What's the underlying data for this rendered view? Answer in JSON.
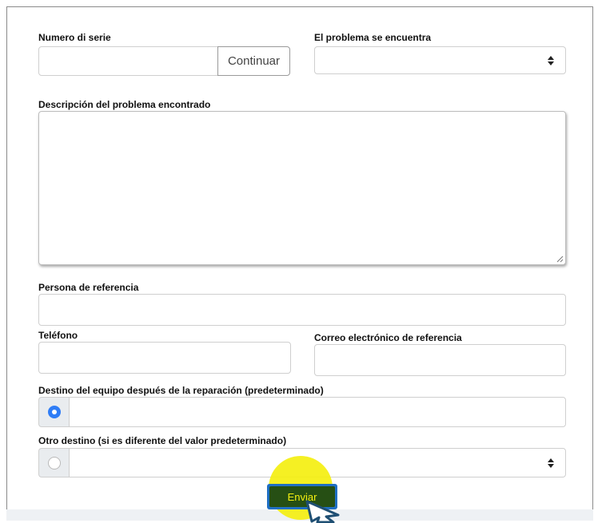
{
  "form": {
    "serial_label": "Numero di serie",
    "serial_value": "",
    "continue_label": "Continuar",
    "problem_location_label": "El problema se encuentra",
    "problem_location_value": "",
    "description_label": "Descripción del problema encontrado",
    "description_value": "",
    "contact_person_label": "Persona de referencia",
    "contact_person_value": "",
    "phone_label": "Teléfono",
    "phone_value": "",
    "email_label": "Correo electrónico de referencia",
    "email_value": "",
    "default_destination_label": "Destino del equipo después de la reparación (predeterminado)",
    "default_destination_value": "",
    "other_destination_label": "Otro destino (si es diferente del valor predeterminado)",
    "other_destination_value": "",
    "submit_label": "Enviar"
  },
  "colors": {
    "primary_button": "#1f6fc4",
    "radio_selected": "#2f7df6",
    "click_highlight": "#f4ef10"
  },
  "icons": {
    "select_caret": "updown-caret-icon",
    "cursor": "mouse-pointer-icon",
    "resize": "resize-grip-icon"
  }
}
